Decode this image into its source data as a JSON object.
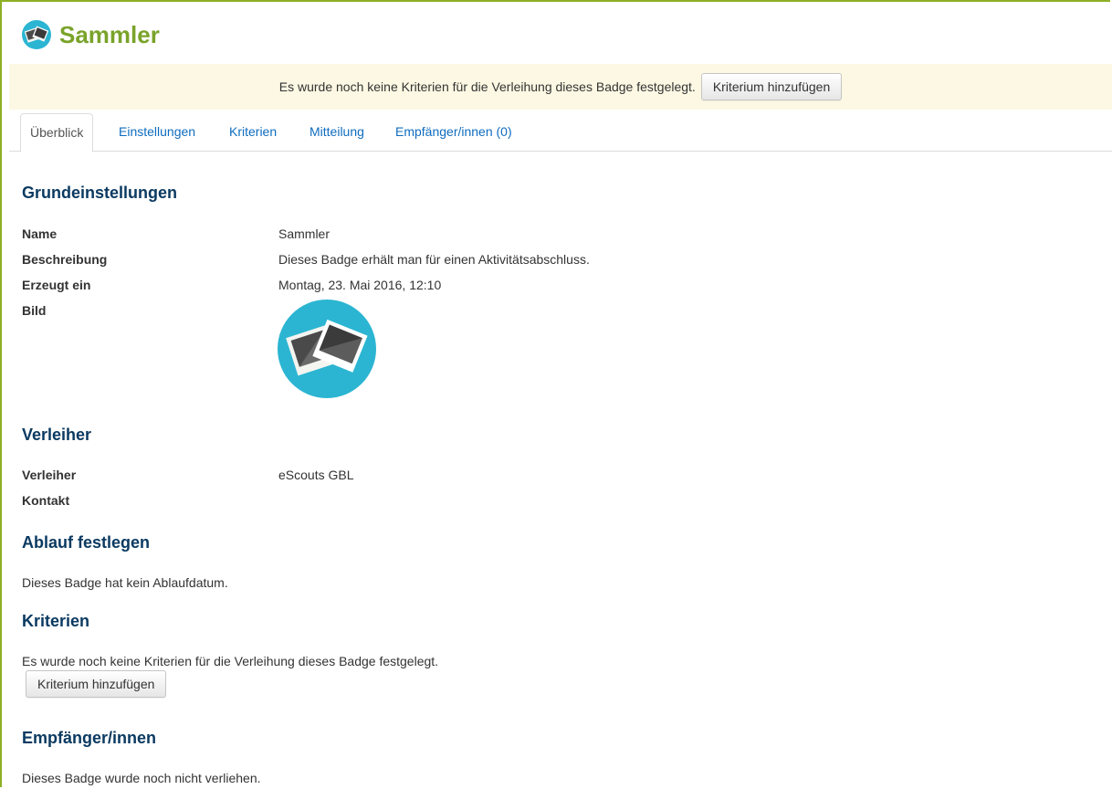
{
  "header": {
    "title": "Sammler",
    "icon": "badge-photos-icon"
  },
  "notice": {
    "text": "Es wurde noch keine Kriterien für die Verleihung dieses Badge festgelegt.",
    "button_label": "Kriterium hinzufügen"
  },
  "tabs": [
    {
      "label": "Überblick",
      "active": true
    },
    {
      "label": "Einstellungen"
    },
    {
      "label": "Kriterien"
    },
    {
      "label": "Mitteilung"
    },
    {
      "label": "Empfänger/innen (0)"
    }
  ],
  "basic": {
    "heading": "Grundeinstellungen",
    "rows": [
      {
        "label": "Name",
        "value": "Sammler"
      },
      {
        "label": "Beschreibung",
        "value": "Dieses Badge erhält man für einen Aktivitätsabschluss."
      },
      {
        "label": "Erzeugt ein",
        "value": "Montag, 23. Mai 2016, 12:10"
      },
      {
        "label": "Bild",
        "value": ""
      }
    ]
  },
  "issuer": {
    "heading": "Verleiher",
    "rows": [
      {
        "label": "Verleiher",
        "value": "eScouts GBL"
      },
      {
        "label": "Kontakt",
        "value": ""
      }
    ]
  },
  "expiry": {
    "heading": "Ablauf festlegen",
    "text": "Dieses Badge hat kein Ablaufdatum."
  },
  "criteria": {
    "heading": "Kriterien",
    "text": "Es wurde noch keine Kriterien für die Verleihung dieses Badge festgelegt.",
    "button_label": "Kriterium hinzufügen"
  },
  "recipients": {
    "heading": "Empfänger/innen",
    "text": "Dieses Badge wurde noch nicht verliehen."
  },
  "colors": {
    "accent_green": "#7aa32a",
    "heading_blue": "#0b3a61",
    "link_blue": "#0f6cbf",
    "notice_bg": "#fcf8e3",
    "badge_teal": "#2bb5d2"
  }
}
